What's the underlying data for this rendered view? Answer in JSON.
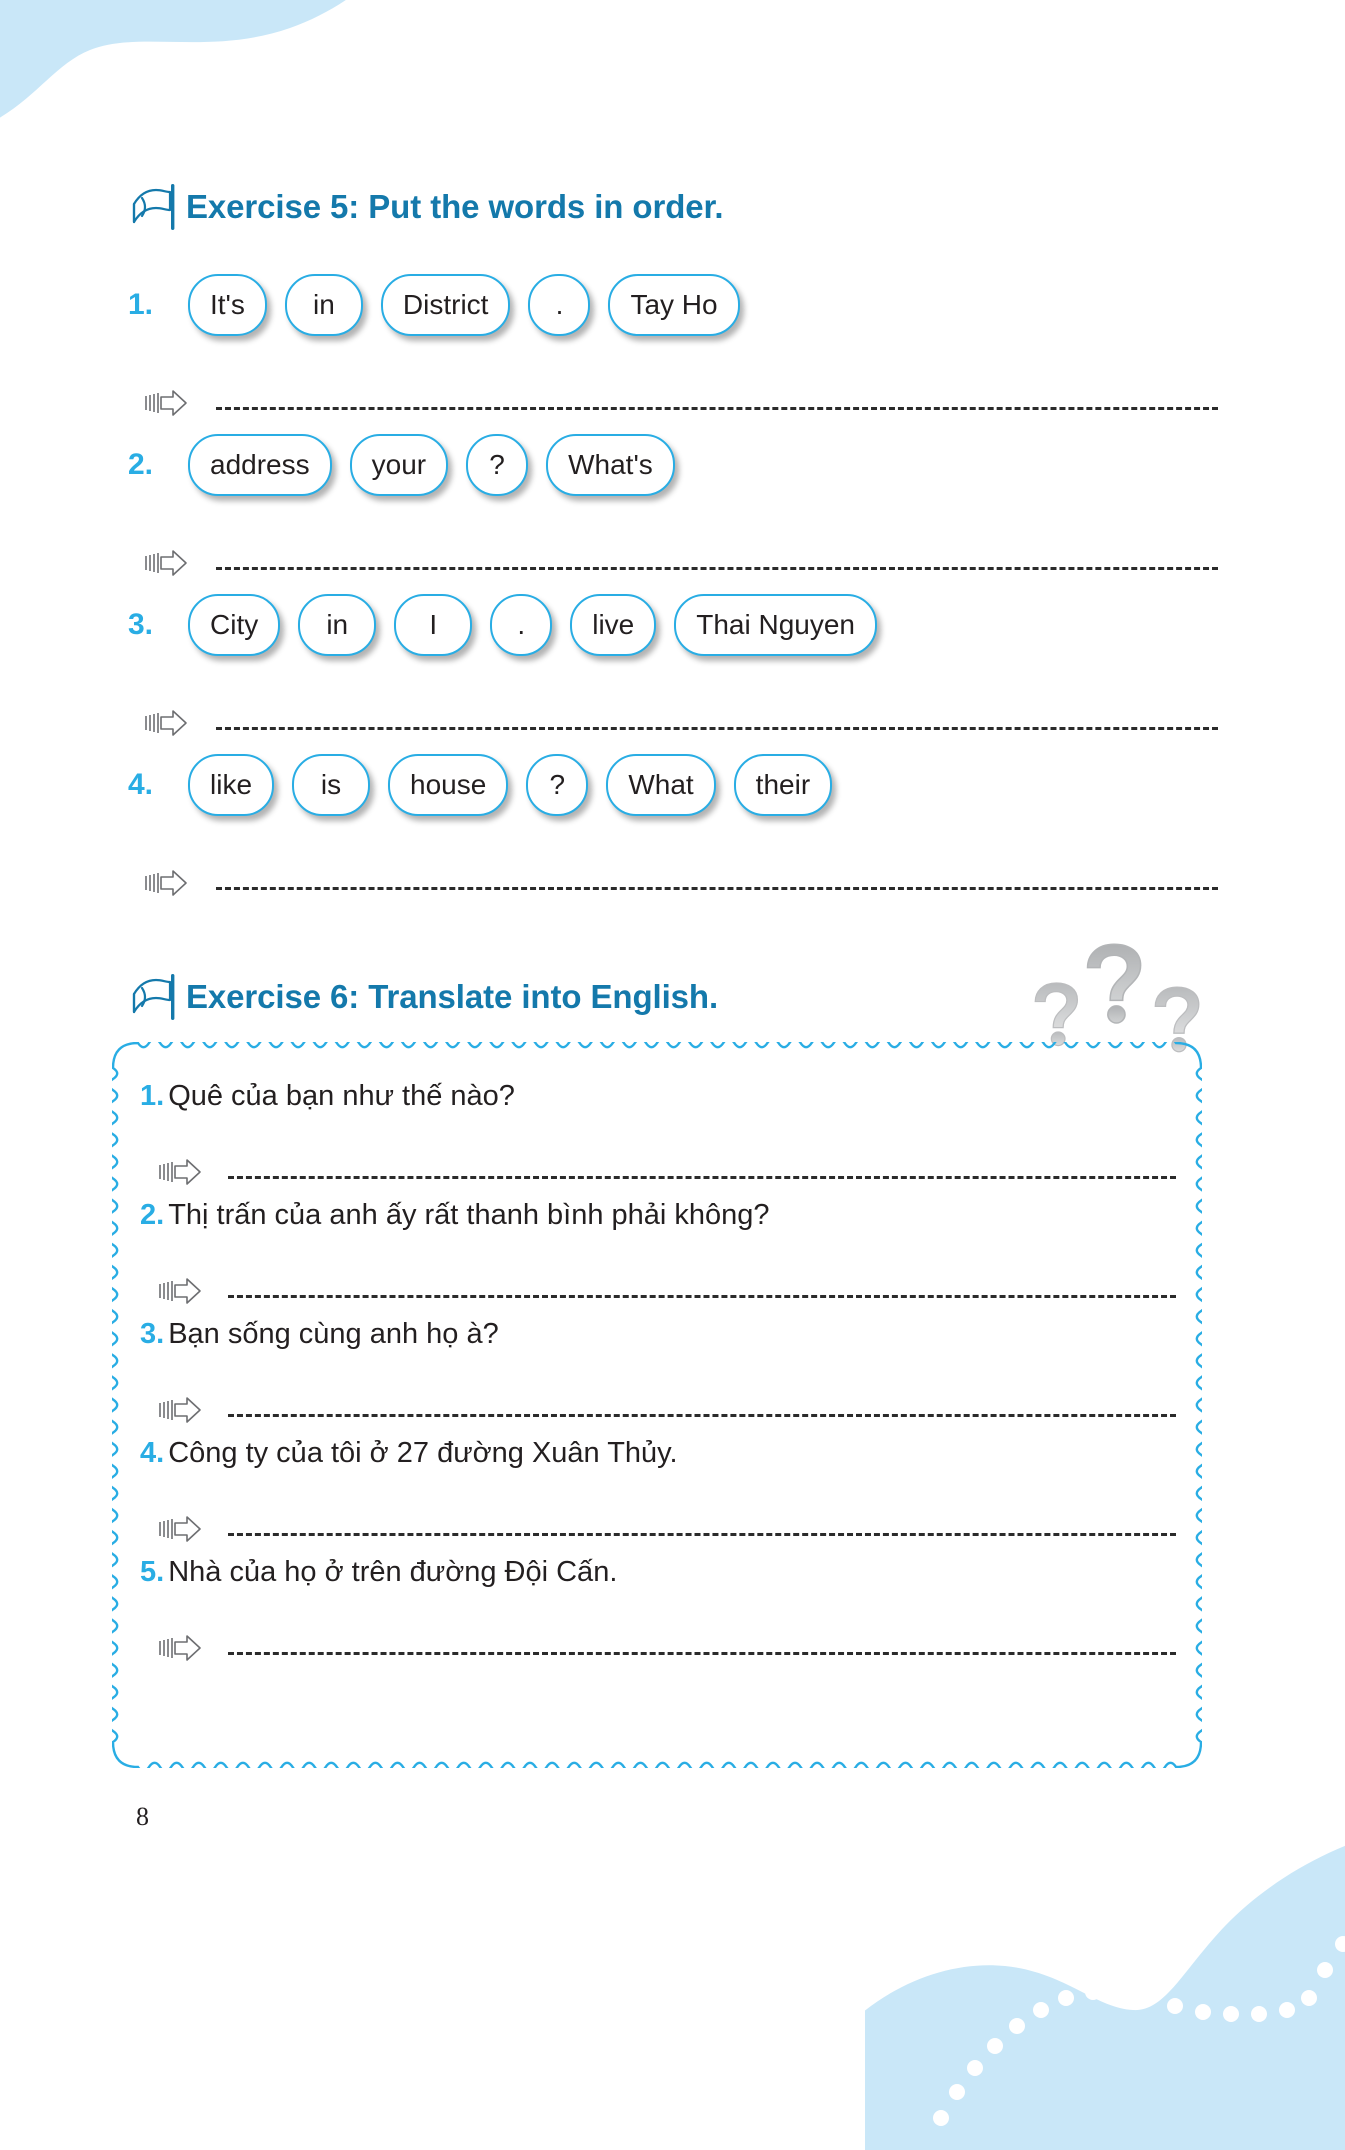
{
  "page": {
    "number": "8",
    "accent_blue": "#29ade4",
    "heading_blue": "#1479ab",
    "cloud_fill": "#c9e7f8",
    "text_color": "#231f20"
  },
  "exercise5": {
    "title": "Exercise 5: Put the words in order.",
    "icon": "flag-icon",
    "rows": [
      {
        "number": "1.",
        "words": [
          "It's",
          "in",
          "District",
          ".",
          "Tay Ho"
        ]
      },
      {
        "number": "2.",
        "words": [
          "address",
          "your",
          "?",
          "What's"
        ]
      },
      {
        "number": "3.",
        "words": [
          "City",
          "in",
          "I",
          ".",
          "live",
          "Thai Nguyen"
        ]
      },
      {
        "number": "4.",
        "words": [
          "like",
          "is",
          "house",
          "?",
          "What",
          "their"
        ]
      }
    ]
  },
  "exercise6": {
    "title": "Exercise 6: Translate into English.",
    "icon": "flag-icon",
    "decoration": "question-marks-icon",
    "items": [
      {
        "number": "1.",
        "sentence": "Quê của bạn như thế nào?"
      },
      {
        "number": "2.",
        "sentence": "Thị trấn của anh ấy rất thanh bình phải không?"
      },
      {
        "number": "3.",
        "sentence": "Bạn sống cùng anh họ à?"
      },
      {
        "number": "4.",
        "sentence": "Công ty của tôi ở 27 đường Xuân Thủy."
      },
      {
        "number": "5.",
        "sentence": "Nhà của họ ở trên đường Đội Cấn."
      }
    ]
  }
}
